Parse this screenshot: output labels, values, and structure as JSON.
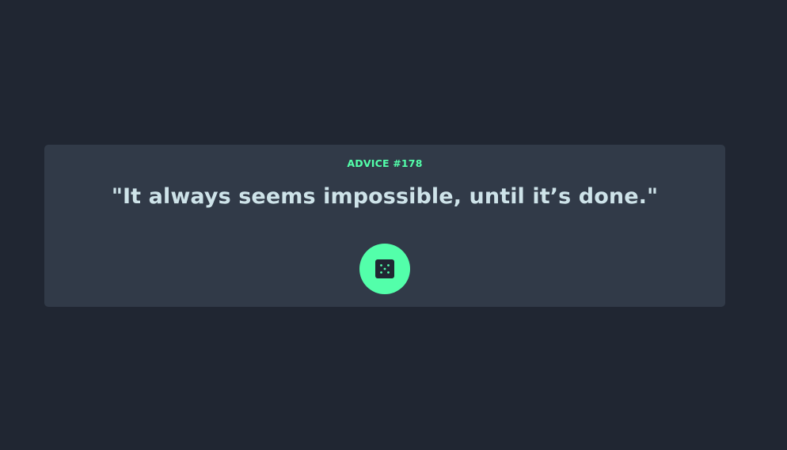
{
  "advice": {
    "id_label": "ADVICE #178",
    "quote": "\"It always seems impossible, until it’s done.\""
  },
  "dice_button": {
    "icon": "dice-icon"
  },
  "colors": {
    "background": "#202632",
    "card": "#313a48",
    "accent": "#53ffaa",
    "text": "#cee3e9"
  }
}
